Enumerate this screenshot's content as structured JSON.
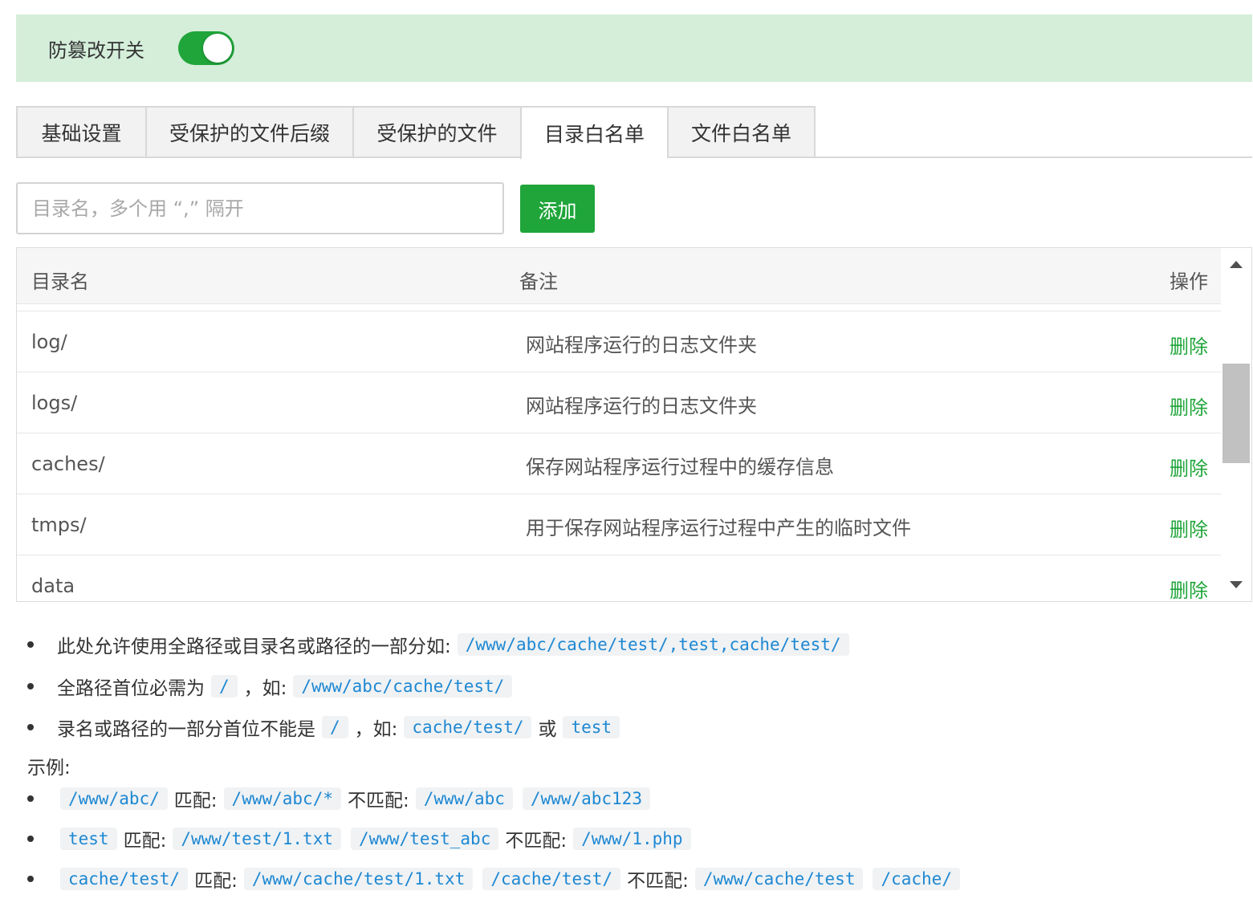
{
  "banner": {
    "label": "防篡改开关",
    "toggle_on": true
  },
  "tabs": [
    {
      "label": "基础设置",
      "active": false
    },
    {
      "label": "受保护的文件后缀",
      "active": false
    },
    {
      "label": "受保护的文件",
      "active": false
    },
    {
      "label": "目录白名单",
      "active": true
    },
    {
      "label": "文件白名单",
      "active": false
    }
  ],
  "add_form": {
    "placeholder": "目录名，多个用 “,” 隔开",
    "button_label": "添加"
  },
  "table": {
    "headers": {
      "name": "目录名",
      "note": "备注",
      "op": "操作"
    },
    "rows": [
      {
        "name": "log/",
        "note": "网站程序运行的日志文件夹",
        "op": "删除"
      },
      {
        "name": "logs/",
        "note": "网站程序运行的日志文件夹",
        "op": "删除"
      },
      {
        "name": "caches/",
        "note": "保存网站程序运行过程中的缓存信息",
        "op": "删除"
      },
      {
        "name": "tmps/",
        "note": "用于保存网站程序运行过程中产生的临时文件",
        "op": "删除"
      },
      {
        "name": "data",
        "note": "",
        "op": "删除"
      }
    ]
  },
  "help": {
    "line1": {
      "text": "此处允许使用全路径或目录名或路径的一部分如:",
      "code": "/www/abc/cache/test/,test,cache/test/"
    },
    "line2": {
      "text": "全路径首位必需为",
      "code1": "/",
      "sep": "，如:",
      "code2": "/www/abc/cache/test/"
    },
    "line3": {
      "text": "录名或路径的一部分首位不能是",
      "code1": "/",
      "sep": "，如:",
      "code2": "cache/test/",
      "or": "或",
      "code3": "test"
    },
    "example_title": "示例:",
    "ex1": {
      "code1": "/www/abc/",
      "match": "匹配:",
      "code2": "/www/abc/*",
      "nomatch": "不匹配:",
      "code3": "/www/abc",
      "code4": "/www/abc123"
    },
    "ex2": {
      "code1": "test",
      "match": "匹配:",
      "code2": "/www/test/1.txt",
      "code3": "/www/test_abc",
      "nomatch": "不匹配:",
      "code4": "/www/1.php"
    },
    "ex3": {
      "code1": "cache/test/",
      "match": "匹配:",
      "code2": "/www/cache/test/1.txt",
      "code3": "/cache/test/",
      "nomatch": "不匹配:",
      "code4": "/www/cache/test",
      "code5": "/cache/"
    }
  }
}
